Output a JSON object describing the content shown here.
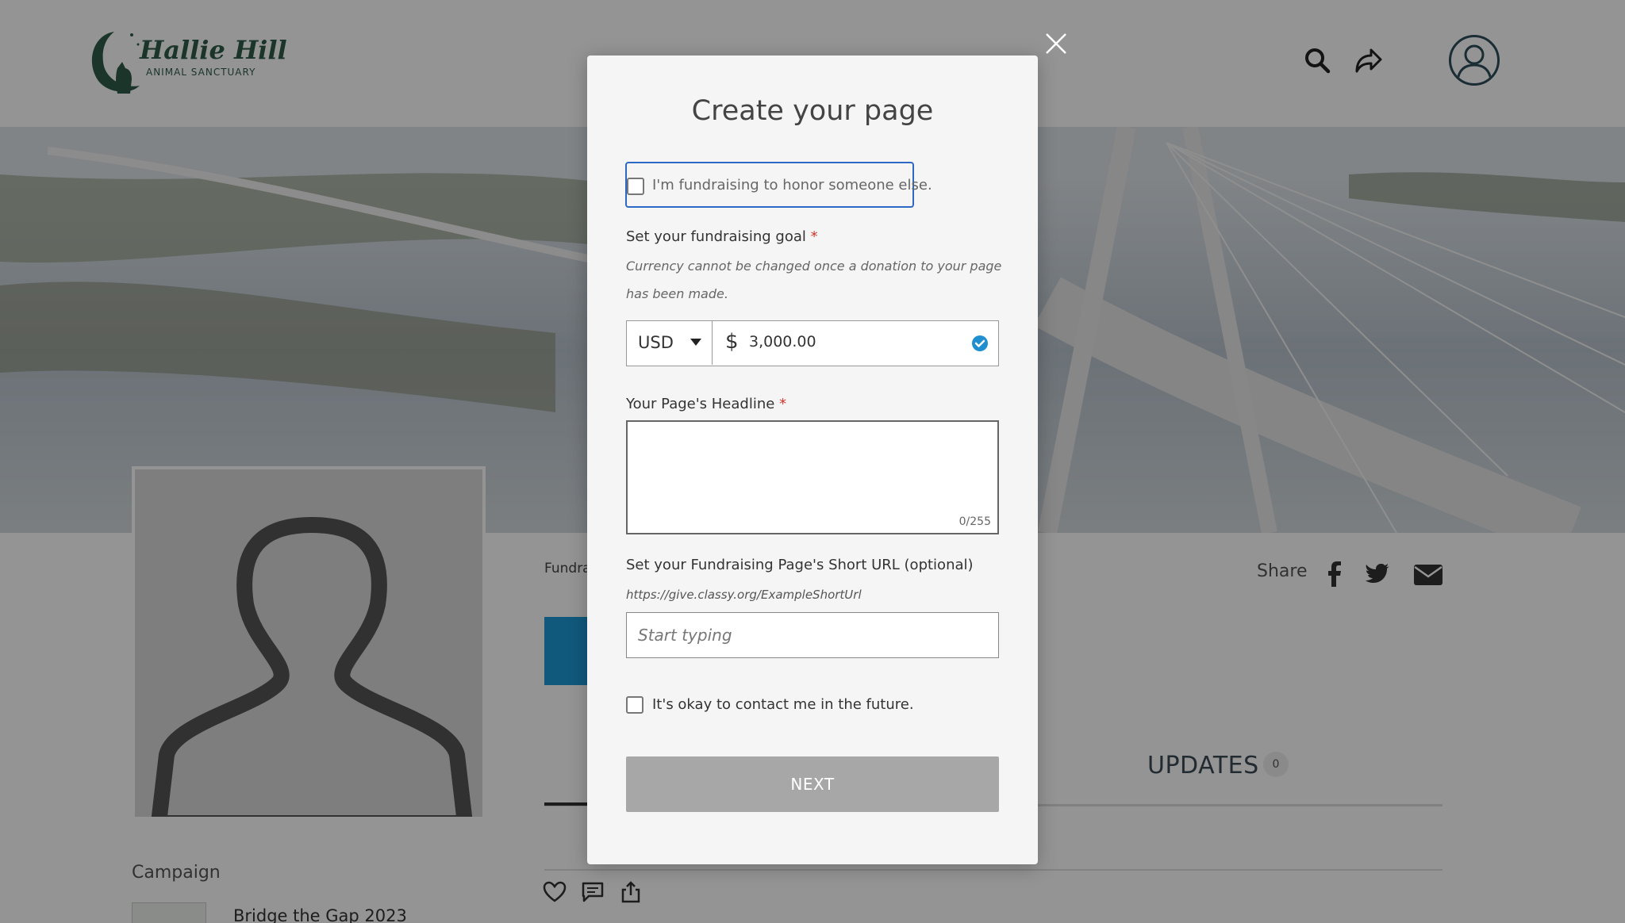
{
  "header": {
    "logo_title": "Hallie Hill",
    "logo_subtitle": "ANIMAL SANCTUARY"
  },
  "page": {
    "fundraiser_label": "Fundra",
    "share_label": "Share",
    "tab_updates_label": "UPDATES",
    "tab_updates_count": "0",
    "campaign_label": "Campaign",
    "campaign_name": "Bridge the Gap 2023"
  },
  "modal": {
    "title": "Create your page",
    "honor_checkbox_label": "I'm fundraising to honor someone else.",
    "goal_label": "Set your fundraising goal",
    "required_mark": "*",
    "goal_helper": "Currency cannot be changed once a donation to your page has been made.",
    "currency": "USD",
    "currency_symbol": "$",
    "goal_amount": "3,000.00",
    "headline_label": "Your Page's Headline",
    "headline_value": "",
    "headline_count": "0/255",
    "short_url_label": "Set your Fundraising Page's Short URL (optional)",
    "short_url_example": "https://give.classy.org/ExampleShortUrl",
    "short_url_placeholder": "Start typing",
    "contact_checkbox_label": "It's okay to contact me in the future.",
    "next_button": "NEXT"
  },
  "colors": {
    "brand_green": "#2f5c4a",
    "focus_blue": "#2d68c4",
    "check_blue": "#1f8fcf",
    "required_red": "#d0342c",
    "disabled_button": "#a7a7a7",
    "donate_blue": "#1c9ad6"
  },
  "icons": [
    "logo-cat-moon-icon",
    "search-icon",
    "share-arrow-icon",
    "user-avatar-icon",
    "facebook-icon",
    "twitter-icon",
    "email-icon",
    "heart-icon",
    "comment-icon",
    "upload-icon",
    "close-icon",
    "chevron-down-icon",
    "check-circle-icon"
  ]
}
